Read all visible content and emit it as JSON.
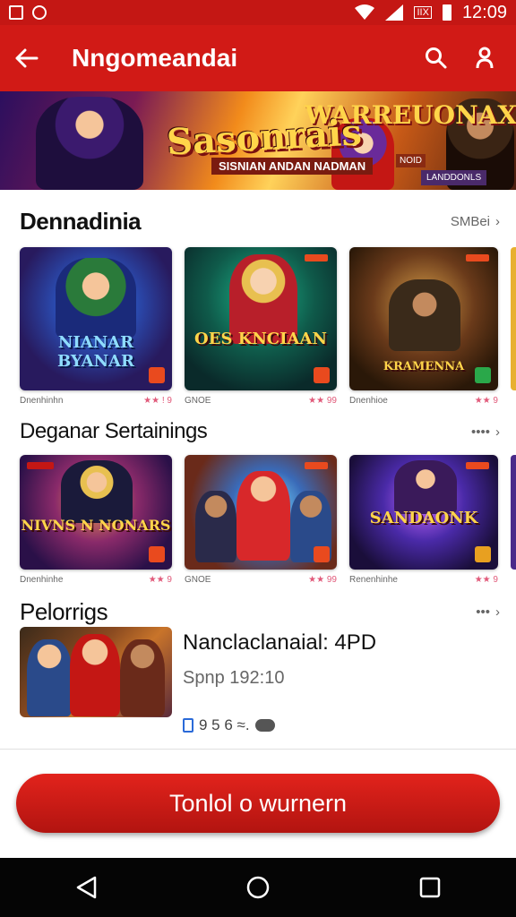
{
  "status_bar": {
    "time": "12:09",
    "battery_label": "▮",
    "signal_box": "IIX"
  },
  "app_bar": {
    "title": "Nngomeandai"
  },
  "banner": {
    "title_main": "Sasonrais",
    "title_top": "WARREUONAX",
    "subtitle": "SISNIAN ANDAN NADMAN",
    "chip1": "NOID",
    "chip2": "LANDDONLS"
  },
  "sections": [
    {
      "title": "Dennadinia",
      "more": "SMBei",
      "cards": [
        {
          "title": "NIANAR BYANAR",
          "meta_left": "Dnenhinhn",
          "meta_right": "★★ ! 9"
        },
        {
          "title": "OES KNCIAAN",
          "meta_left": "GNOE",
          "meta_right": "★★ 99"
        },
        {
          "title": "KRAMENNA",
          "meta_left": "Dnenhioe",
          "meta_right": "★★ 9"
        }
      ]
    },
    {
      "title": "Deganar Sertainings",
      "more": "••••",
      "cards": [
        {
          "title": "NIVNS N NONARS",
          "meta_left": "Dnenhinhe",
          "meta_right": "★★ 9"
        },
        {
          "title": "",
          "meta_left": "GNOE",
          "meta_right": "★★ 99"
        },
        {
          "title": "SANDAONK",
          "meta_left": "Renenhinhe",
          "meta_right": "★★ 9"
        }
      ]
    },
    {
      "title": "Pelorrigs",
      "more": "•••"
    }
  ],
  "featured": {
    "title": "Nanclaclanaial: 4PD",
    "subtitle": "Spnp 192:10",
    "stats": "9 5 6  ≈."
  },
  "cta": {
    "label": "Tonlol o wurnern"
  },
  "colors": {
    "primary": "#d11a16",
    "accent": "#ffd54a"
  }
}
